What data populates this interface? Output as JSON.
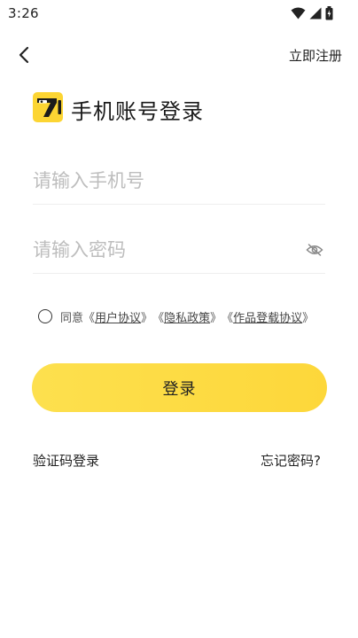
{
  "status_bar": {
    "time": "3:26"
  },
  "nav": {
    "back_icon": "chevron-left-icon",
    "register_label": "立即注册"
  },
  "header": {
    "logo_icon": "app-logo-icon",
    "title": "手机账号登录"
  },
  "form": {
    "phone_placeholder": "请输入手机号",
    "password_placeholder": "请输入密码",
    "password_toggle_icon": "eye-off-icon"
  },
  "agreement": {
    "prefix": "同意",
    "links": [
      "用户协议",
      "隐私政策",
      "作品登载协议"
    ],
    "checked": false
  },
  "actions": {
    "login_label": "登录",
    "sms_login_label": "验证码登录",
    "forgot_password_label": "忘记密码?"
  },
  "colors": {
    "accent": "#fdd93f",
    "logo_bg": "#fcd533"
  }
}
